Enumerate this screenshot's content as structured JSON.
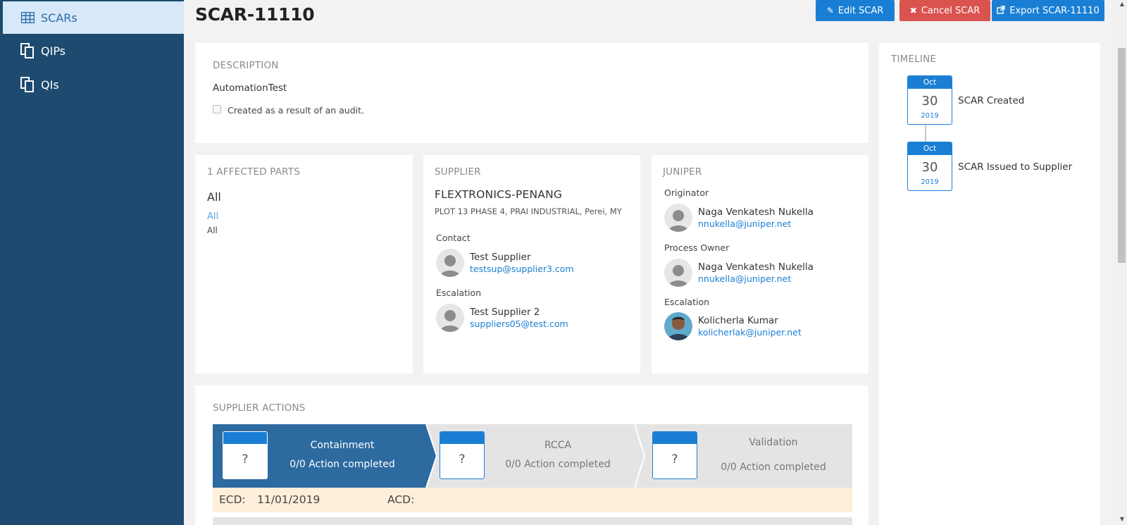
{
  "sidebar": {
    "items": [
      {
        "label": "SCARs",
        "icon": "table-icon"
      },
      {
        "label": "QIPs",
        "icon": "documents-icon"
      },
      {
        "label": "QIs",
        "icon": "documents-icon"
      }
    ]
  },
  "header": {
    "title": "SCAR-11110",
    "edit_label": "Edit SCAR",
    "cancel_label": "Cancel SCAR",
    "export_label": "Export SCAR-11110"
  },
  "description": {
    "heading": "DESCRIPTION",
    "text": "AutomationTest",
    "audit_label": "Created as a result of an audit."
  },
  "parts": {
    "heading": "1 AFFECTED PARTS",
    "title": "All",
    "link": "All",
    "sub": "All"
  },
  "supplier": {
    "heading": "SUPPLIER",
    "name": "FLEXTRONICS-PENANG",
    "address": "PLOT 13 PHASE 4, PRAI INDUSTRIAL, Perei, MY",
    "contact_label": "Contact",
    "contact": {
      "name": "Test Supplier",
      "email": "testsup@supplier3.com"
    },
    "escalation_label": "Escalation",
    "escalation": {
      "name": "Test Supplier 2",
      "email": "suppliers05@test.com"
    }
  },
  "juniper": {
    "heading": "JUNIPER",
    "originator_label": "Originator",
    "originator": {
      "name": "Naga Venkatesh Nukella",
      "email": "nnukella@juniper.net"
    },
    "owner_label": "Process Owner",
    "owner": {
      "name": "Naga Venkatesh Nukella",
      "email": "nnukella@juniper.net"
    },
    "escalation_label": "Escalation",
    "escalation": {
      "name": "Kolicherla Kumar",
      "email": "kolicherlak@juniper.net"
    }
  },
  "timeline": {
    "heading": "TIMELINE",
    "events": [
      {
        "month": "Oct",
        "day": "30",
        "year": "2019",
        "label": "SCAR Created"
      },
      {
        "month": "Oct",
        "day": "30",
        "year": "2019",
        "label": "SCAR Issued to Supplier"
      }
    ]
  },
  "actions": {
    "heading": "SUPPLIER ACTIONS",
    "steps": [
      {
        "title": "Containment",
        "status": "0/0 Action completed",
        "badge": "?"
      },
      {
        "title": "RCCA",
        "status": "0/0 Action completed",
        "badge": "?"
      },
      {
        "title": "Validation",
        "status": "0/0 Action completed",
        "badge": "?"
      }
    ],
    "ecd_label": "ECD:",
    "ecd_value": "11/01/2019",
    "acd_label": "ACD:",
    "acd_value": ""
  },
  "colors": {
    "sidebar": "#1d4a6e",
    "primary": "#1a7fd4",
    "danger": "#d9534f",
    "active_step": "#2d6aa0",
    "ecd_bg": "#fdefd9"
  }
}
